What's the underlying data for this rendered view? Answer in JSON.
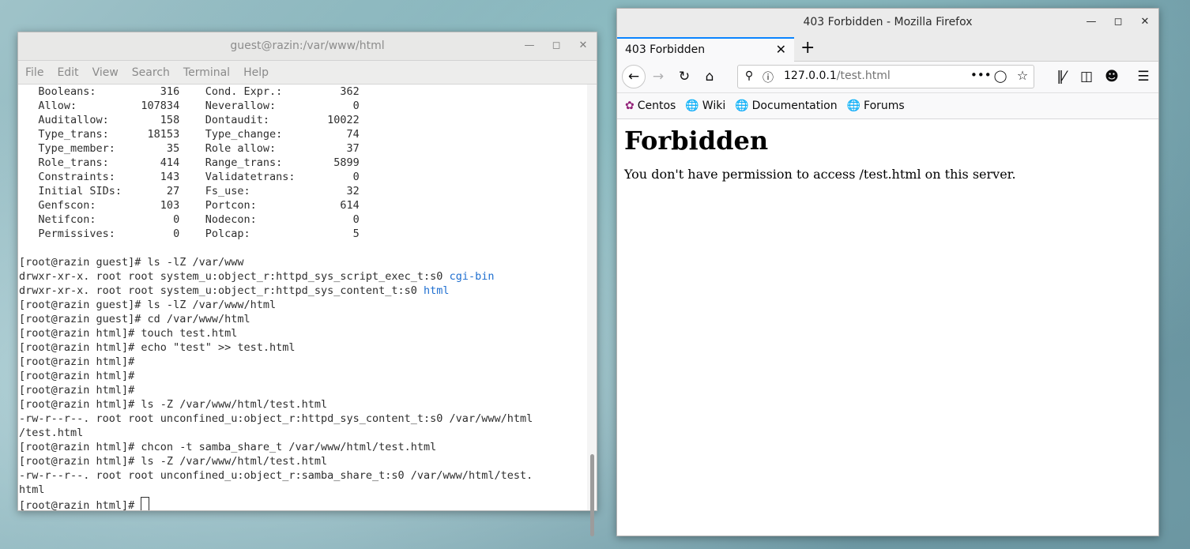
{
  "terminal": {
    "title": "guest@razin:/var/www/html",
    "menu": [
      "File",
      "Edit",
      "View",
      "Search",
      "Terminal",
      "Help"
    ],
    "stats": [
      [
        "Booleans:",
        "316",
        "Cond. Expr.:",
        "362"
      ],
      [
        "Allow:",
        "107834",
        "Neverallow:",
        "0"
      ],
      [
        "Auditallow:",
        "158",
        "Dontaudit:",
        "10022"
      ],
      [
        "Type_trans:",
        "18153",
        "Type_change:",
        "74"
      ],
      [
        "Type_member:",
        "35",
        "Role allow:",
        "37"
      ],
      [
        "Role_trans:",
        "414",
        "Range_trans:",
        "5899"
      ],
      [
        "Constraints:",
        "143",
        "Validatetrans:",
        "0"
      ],
      [
        "Initial SIDs:",
        "27",
        "Fs_use:",
        "32"
      ],
      [
        "Genfscon:",
        "103",
        "Portcon:",
        "614"
      ],
      [
        "Netifcon:",
        "0",
        "Nodecon:",
        "0"
      ],
      [
        "Permissives:",
        "0",
        "Polcap:",
        "5"
      ]
    ],
    "lines": [
      "",
      "[root@razin guest]# ls -lZ /var/www",
      "drwxr-xr-x. root root system_u:object_r:httpd_sys_script_exec_t:s0 ",
      "drwxr-xr-x. root root system_u:object_r:httpd_sys_content_t:s0 ",
      "[root@razin guest]# ls -lZ /var/www/html",
      "[root@razin guest]# cd /var/www/html",
      "[root@razin html]# touch test.html",
      "[root@razin html]# echo \"test\" >> test.html",
      "[root@razin html]#",
      "[root@razin html]#",
      "[root@razin html]#",
      "[root@razin html]# ls -Z /var/www/html/test.html",
      "-rw-r--r--. root root unconfined_u:object_r:httpd_sys_content_t:s0 /var/www/html",
      "/test.html",
      "[root@razin html]# chcon -t samba_share_t /var/www/html/test.html",
      "[root@razin html]# ls -Z /var/www/html/test.html",
      "-rw-r--r--. root root unconfined_u:object_r:samba_share_t:s0 /var/www/html/test.",
      "html",
      "[root@razin html]# "
    ],
    "dir_names": [
      "cgi-bin",
      "html"
    ]
  },
  "firefox": {
    "title": "403 Forbidden - Mozilla Firefox",
    "tab_label": "403 Forbidden",
    "url_host": "127.0.0.1",
    "url_path": "/test.html",
    "bookmarks": [
      "Centos",
      "Wiki",
      "Documentation",
      "Forums"
    ],
    "heading": "Forbidden",
    "message": "You don't have permission to access /test.html on this server."
  },
  "colors": {
    "link_blue": "#1f6fd0",
    "tab_accent": "#0a84ff"
  }
}
